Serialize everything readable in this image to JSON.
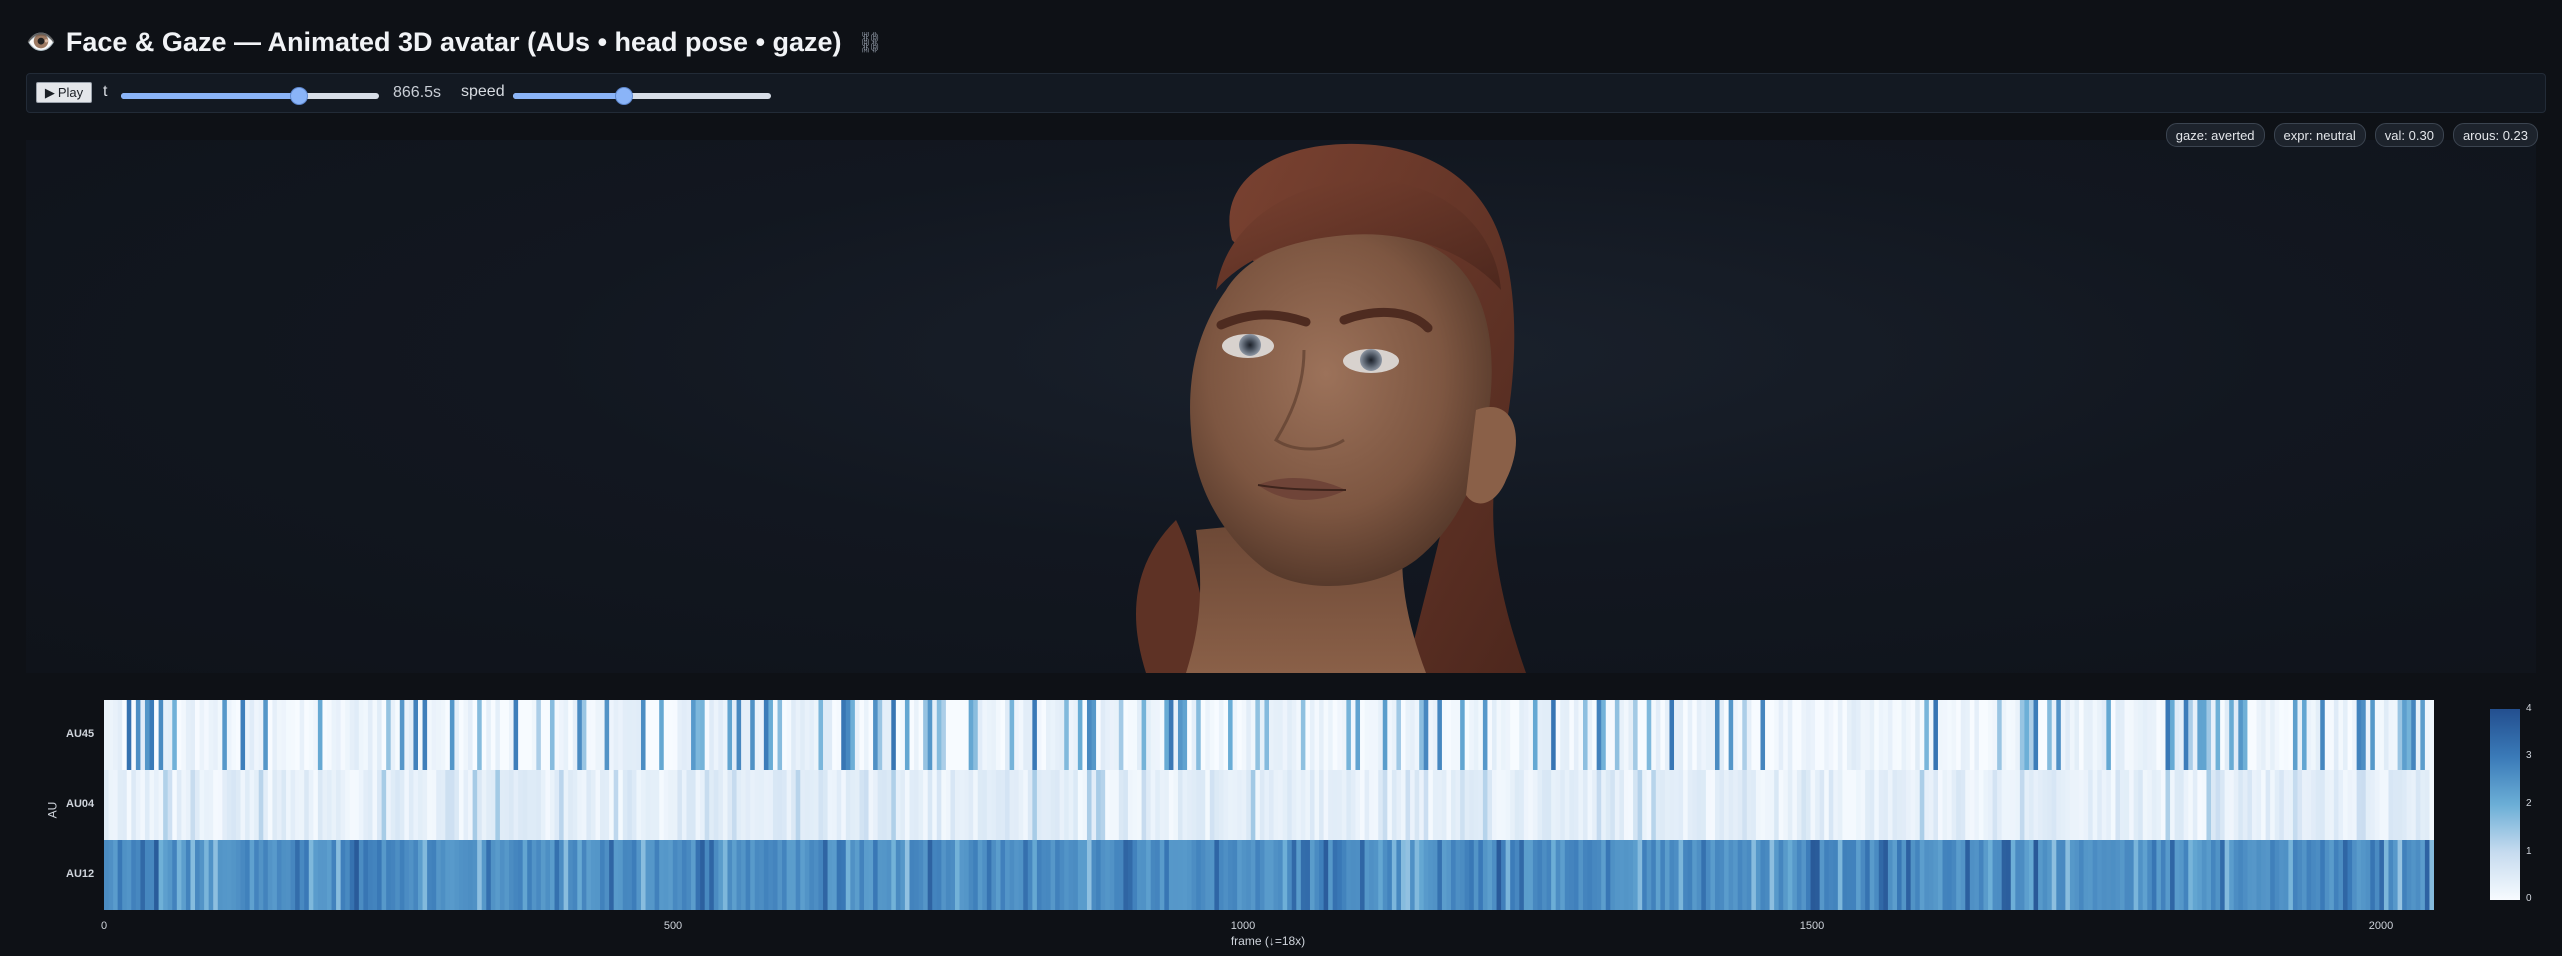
{
  "header": {
    "icon": "eye-icon",
    "title": "Face & Gaze — Animated 3D avatar (AUs • head pose • gaze)",
    "link_icon": "link-icon"
  },
  "controls": {
    "play_label": "Play",
    "t_label": "t",
    "t_fraction": 0.69,
    "t_readout": "866.5s",
    "speed_label": "speed",
    "speed_fraction": 0.43
  },
  "badges": {
    "gaze": "gaze: averted",
    "expr": "expr: neutral",
    "val": "val: 0.30",
    "arous": "arous: 0.23"
  },
  "chart_data": {
    "type": "heatmap",
    "rows": [
      "AU45",
      "AU04",
      "AU12"
    ],
    "xlabel": "frame (↓=18x)",
    "ylabel": "AU",
    "x_ticks": [
      "0",
      "500",
      "1000",
      "1500",
      "2000"
    ],
    "x_tick_values": [
      0,
      500,
      1000,
      1500,
      2000
    ],
    "xlim": [
      0,
      2046
    ],
    "colorbar": {
      "min": 0,
      "max": 4,
      "ticks": [
        "4",
        "3",
        "2",
        "1",
        "0"
      ],
      "colormap": "Blues"
    },
    "row_profiles": {
      "AU45": {
        "baseline": 0.2,
        "spike_probability": 0.22,
        "spike_max": 3.2
      },
      "AU04": {
        "baseline": 0.35,
        "spike_probability": 0.12,
        "spike_max": 1.4
      },
      "AU12": {
        "baseline": 2.6,
        "spike_probability": 0.3,
        "spike_max": 3.8
      }
    }
  },
  "colors": {
    "background": "#0e1116",
    "accent": "#8ab4f8",
    "skin": "#8a6248",
    "hair": "#6b3a2a"
  }
}
